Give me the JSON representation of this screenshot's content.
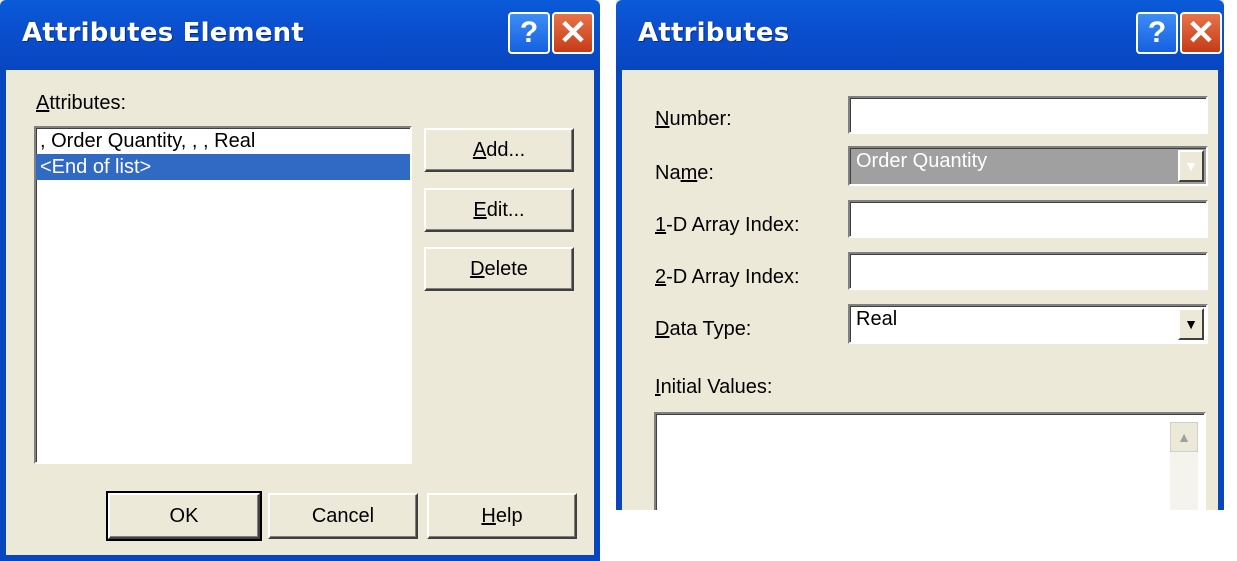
{
  "left_dialog": {
    "title": "Attributes Element",
    "help_glyph": "?",
    "close_glyph": "✕",
    "list_label": "Attributes:",
    "list_label_hotkey": "A",
    "list_label_rest": "ttributes:",
    "list_items": [
      ", Order Quantity, , , Real",
      "<End of list>"
    ],
    "selected_index": 1,
    "buttons": {
      "add_hotkey": "A",
      "add_rest": "dd...",
      "edit_hotkey": "E",
      "edit_rest": "dit...",
      "delete_hotkey": "D",
      "delete_rest": "elete",
      "ok": "OK",
      "cancel": "Cancel",
      "help_hotkey": "H",
      "help_rest": "elp"
    }
  },
  "right_dialog": {
    "title": "Attributes",
    "help_glyph": "?",
    "close_glyph": "✕",
    "number_label_hotkey": "N",
    "number_label_rest": "umber:",
    "number_value": "",
    "name_label_pre": "Na",
    "name_label_hotkey": "m",
    "name_label_rest": "e:",
    "name_value": "Order Quantity",
    "array1_label_hotkey": "1",
    "array1_label_rest": "-D Array Index:",
    "array1_value": "",
    "array2_label_hotkey": "2",
    "array2_label_rest": "-D Array Index:",
    "array2_value": "",
    "datatype_label_hotkey": "D",
    "datatype_label_rest": "ata Type:",
    "datatype_value": "Real",
    "initial_label_hotkey": "I",
    "initial_label_rest": "nitial Values:",
    "dropdown_glyph": "▼",
    "scroll_up_glyph": "▲"
  },
  "colors": {
    "title_bar": "#0a4fcf",
    "dialog_bg": "#ece9d8",
    "selection": "#316ac5",
    "close_button": "#d24a22"
  }
}
